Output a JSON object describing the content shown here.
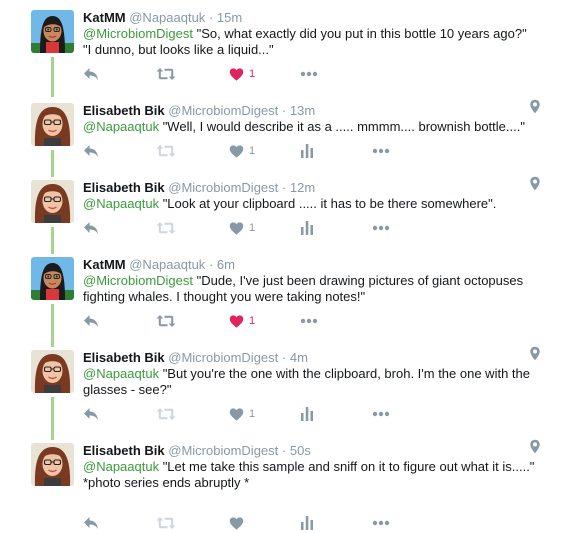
{
  "tweets": [
    {
      "name": "KatMM",
      "handle": "@Napaaqtuk",
      "separator": "·",
      "time": "15m",
      "mention": "@MicrobiomDigest",
      "text": " \"So, what exactly did you put in this bottle 10 years ago?\"",
      "text2": "\"I dunno, but looks like a liquid...\"",
      "extra": "",
      "like_count": "1",
      "liked": true,
      "has_geo": false
    },
    {
      "name": "Elisabeth Bik",
      "handle": "@MicrobiomDigest",
      "separator": "·",
      "time": "13m",
      "mention": "@Napaaqtuk",
      "text": " \"Well, I would describe it as a ..... mmmm.... brownish bottle....\"",
      "text2": "",
      "extra": "",
      "like_count": "1",
      "liked": false,
      "has_geo": true
    },
    {
      "name": "Elisabeth Bik",
      "handle": "@MicrobiomDigest",
      "separator": "·",
      "time": "12m",
      "mention": "@Napaaqtuk",
      "text": " \"Look at your clipboard ..... it has to be there somewhere\".",
      "text2": "",
      "extra": "",
      "like_count": "1",
      "liked": false,
      "has_geo": true
    },
    {
      "name": "KatMM",
      "handle": "@Napaaqtuk",
      "separator": "·",
      "time": "6m",
      "mention": "@MicrobiomDigest",
      "text": " \"Dude,  I've just been drawing pictures of giant octopuses fighting whales. I thought you were taking notes!\"",
      "text2": "",
      "extra": "",
      "like_count": "1",
      "liked": true,
      "has_geo": false
    },
    {
      "name": "Elisabeth Bik",
      "handle": "@MicrobiomDigest",
      "separator": "·",
      "time": "4m",
      "mention": "@Napaaqtuk",
      "text": " \"But you're the one with the clipboard, broh. I'm the one with the glasses - see?\"",
      "text2": "",
      "extra": "",
      "like_count": "1",
      "liked": false,
      "has_geo": true
    },
    {
      "name": "Elisabeth Bik",
      "handle": "@MicrobiomDigest",
      "separator": "·",
      "time": "50s",
      "mention": "@Napaaqtuk",
      "text": " \"Let me take this sample and sniff on it to figure out what it is.....\"",
      "text2": "",
      "extra": "*photo series ends abruptly *",
      "like_count": "",
      "liked": false,
      "has_geo": true
    }
  ],
  "colors": {
    "mention": "#3b9b3b",
    "icon": "#8899a6",
    "liked": "#e0245e",
    "thread_line": "#a7d48d",
    "name": "#14171a"
  }
}
